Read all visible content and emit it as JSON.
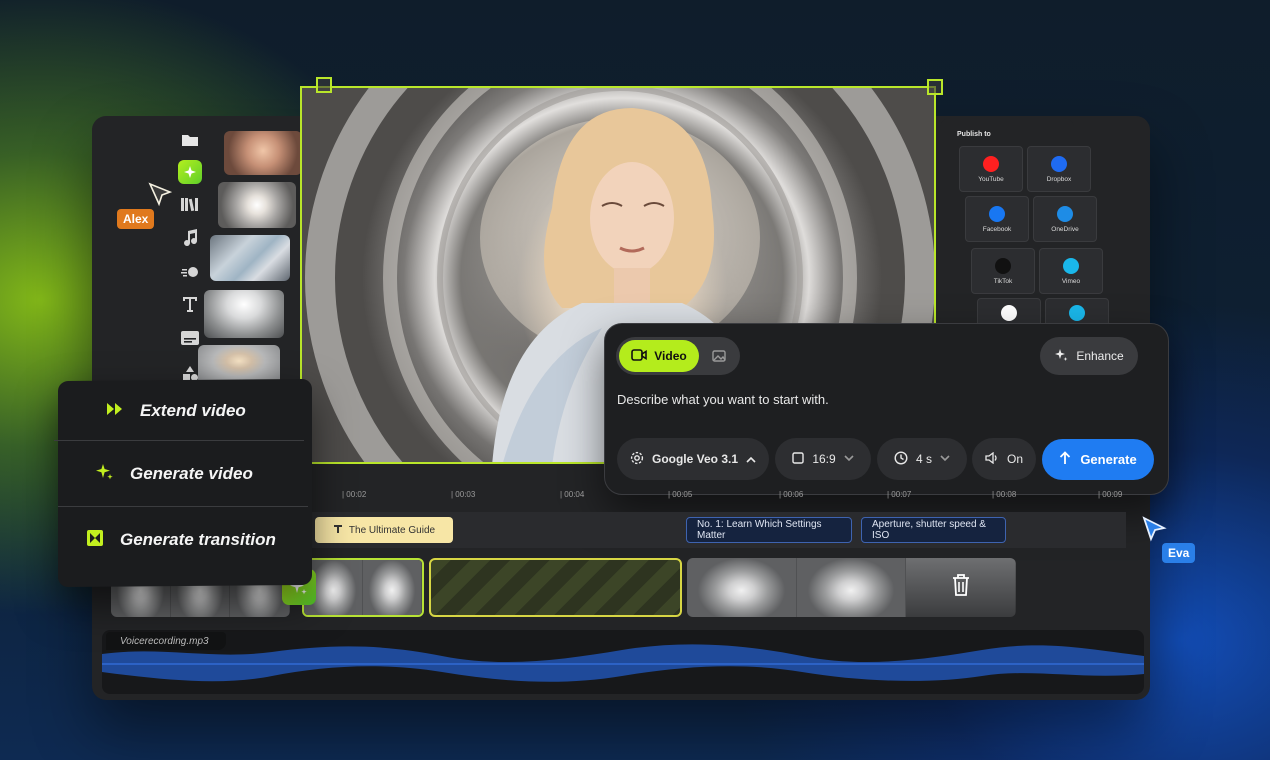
{
  "collaborators": {
    "alex": {
      "name": "Alex",
      "color": "#e0791d"
    },
    "eva": {
      "name": "Eva",
      "color": "#2a7fe8"
    }
  },
  "toolbar": {
    "tools": [
      "folder-icon",
      "ai-sparkle-icon",
      "library-icon",
      "music-icon",
      "motion-icon",
      "text-icon",
      "subtitle-icon",
      "shapes-icon"
    ]
  },
  "publish": {
    "title": "Publish to",
    "targets": [
      {
        "label": "YouTube",
        "icon": "youtube-icon",
        "color": "#ff2020"
      },
      {
        "label": "Dropbox",
        "icon": "dropbox-icon",
        "color": "#1f6bf2"
      },
      {
        "label": "Facebook",
        "icon": "facebook-icon",
        "color": "#1877f2"
      },
      {
        "label": "OneDrive",
        "icon": "onedrive-icon",
        "color": "#1e8ce6"
      },
      {
        "label": "TikTok",
        "icon": "tiktok-icon",
        "color": "#111111"
      },
      {
        "label": "Vimeo",
        "icon": "vimeo-icon",
        "color": "#1ab7ea"
      },
      {
        "label": "",
        "icon": "google-drive-icon",
        "color": "#ffffff"
      },
      {
        "label": "",
        "icon": "play-circle-icon",
        "color": "#1ab7ea"
      }
    ]
  },
  "generator": {
    "mode_video_label": "Video",
    "enhance_label": "Enhance",
    "prompt_text": "Describe what you want to start with.",
    "model": "Google Veo 3.1",
    "aspect_ratio": "16:9",
    "duration": "4 s",
    "audio": "On",
    "generate_label": "Generate"
  },
  "context_menu": {
    "items": [
      {
        "label": "Extend video",
        "icon": "fast-forward-icon"
      },
      {
        "label": "Generate video",
        "icon": "sparkles-icon"
      },
      {
        "label": "Generate transition",
        "icon": "transition-icon"
      }
    ]
  },
  "timeline": {
    "ticks": [
      "| 00:02",
      "| 00:03",
      "| 00:04",
      "| 00:05",
      "| 00:06",
      "| 00:07",
      "| 00:08",
      "| 00:09"
    ],
    "titles": [
      {
        "label": "The Ultimate Guide",
        "style": "yellow"
      },
      {
        "label": "No. 1: Learn Which Settings Matter",
        "style": "dark"
      },
      {
        "label": "Aperture, shutter speed & ISO",
        "style": "dark"
      }
    ],
    "audio_file": "Voicerecording.mp3"
  },
  "colors": {
    "accent": "#b4ec1c",
    "primary_button": "#1f7cf2",
    "panel": "#1e1f21"
  }
}
